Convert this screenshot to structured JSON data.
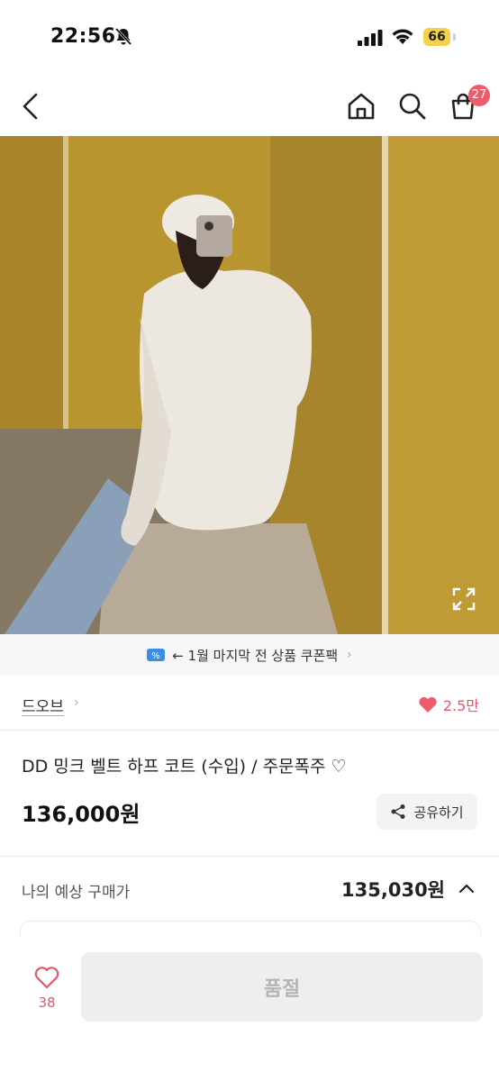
{
  "status_bar": {
    "time": "22:56",
    "battery": "66"
  },
  "nav": {
    "cart_count": "27",
    "icons": [
      "back-arrow-icon",
      "home-icon",
      "search-icon",
      "cart-icon"
    ]
  },
  "gallery": {
    "total_images": 4,
    "active_index": 1
  },
  "coupon_banner": {
    "text": "← 1월 마지막 전 상품 쿠폰팩"
  },
  "shop": {
    "name": "드오브",
    "likes": "2.5만"
  },
  "product": {
    "title": "DD 밍크 벨트 하프 코트 (수입) / 주문폭주 ♡",
    "price": "136,000원",
    "share_label": "공유하기"
  },
  "estimate": {
    "label": "나의 예상 구매가",
    "value": "135,030원"
  },
  "bottom": {
    "wish_count": "38",
    "action_label": "품절"
  },
  "colors": {
    "accent": "#ef5b6a",
    "coupon": "#3a8ee6",
    "wall": "#b0902e"
  }
}
